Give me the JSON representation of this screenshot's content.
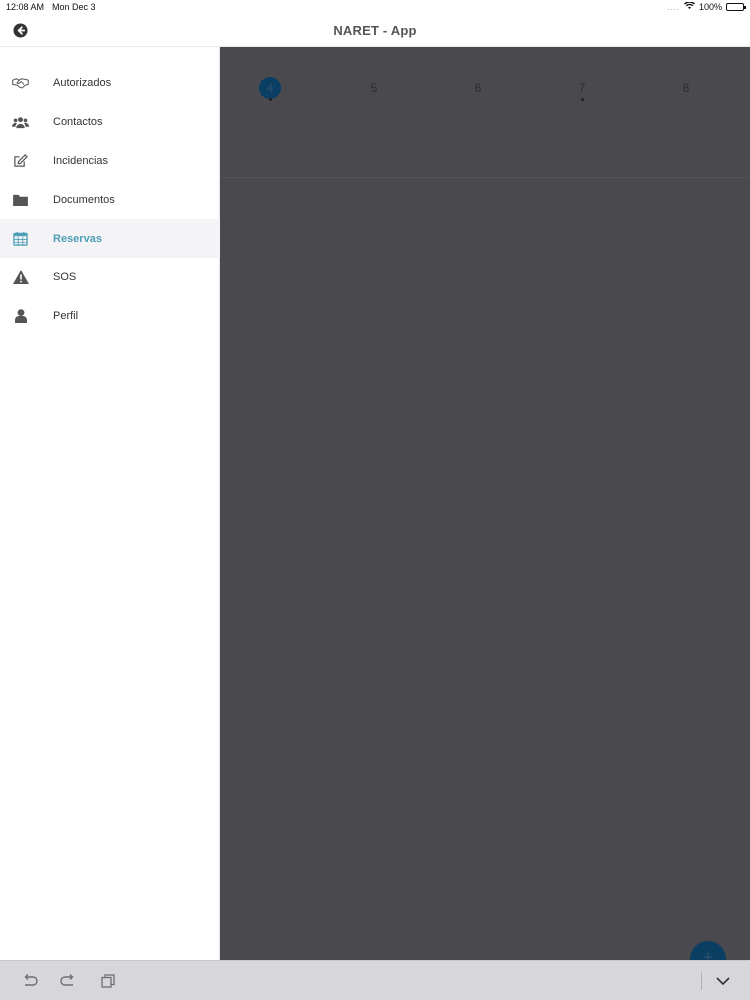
{
  "status_bar": {
    "time": "12:08 AM",
    "date": "Mon Dec 3",
    "signal": "....",
    "battery_label": "100%",
    "battery_level": 1.0
  },
  "header": {
    "title": "NARET - App",
    "back_icon": "back-circle-icon"
  },
  "sidebar": {
    "items": [
      {
        "label": "Autorizados",
        "icon": "handshake-icon",
        "active": false
      },
      {
        "label": "Contactos",
        "icon": "users-icon",
        "active": false
      },
      {
        "label": "Incidencias",
        "icon": "edit-icon",
        "active": false
      },
      {
        "label": "Documentos",
        "icon": "folder-icon",
        "active": false
      },
      {
        "label": "Reservas",
        "icon": "calendar-icon",
        "active": true
      },
      {
        "label": "SOS",
        "icon": "warning-icon",
        "active": false
      },
      {
        "label": "Perfil",
        "icon": "user-icon",
        "active": false
      }
    ]
  },
  "calendar": {
    "days": [
      {
        "num": "4",
        "today": true,
        "has_event": true
      },
      {
        "num": "5",
        "today": false,
        "has_event": false
      },
      {
        "num": "6",
        "today": false,
        "has_event": false
      },
      {
        "num": "7",
        "today": false,
        "has_event": true
      },
      {
        "num": "8",
        "today": false,
        "has_event": false
      }
    ]
  },
  "colors": {
    "accent": "#4e9fb5",
    "primary_dark": "#0a3e63",
    "overlay": "#4a494d",
    "toolbar": "#d7d6db"
  }
}
